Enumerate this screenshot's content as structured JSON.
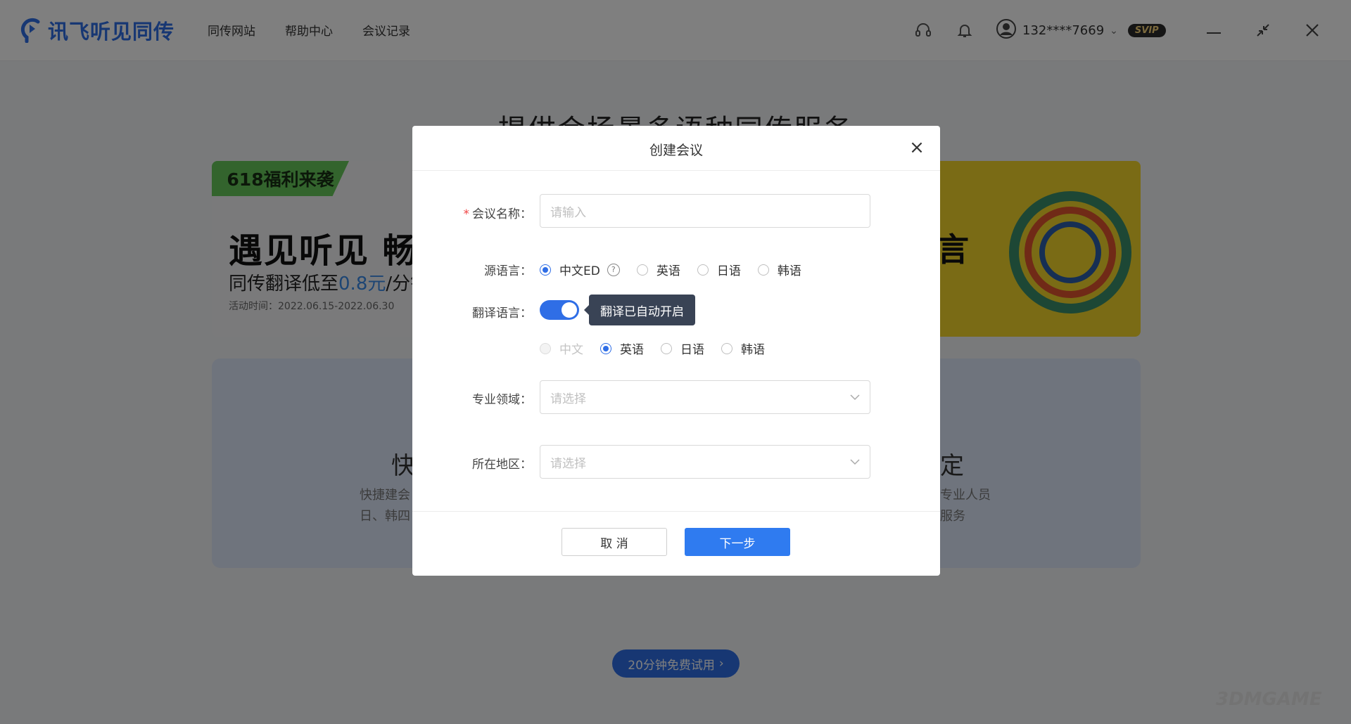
{
  "app": {
    "logo_text": "讯飞听见同传",
    "brand_color": "#2f6ee6"
  },
  "nav": [
    {
      "label": "同传网站"
    },
    {
      "label": "帮助中心"
    },
    {
      "label": "会议记录"
    }
  ],
  "header": {
    "phone": "132****7669",
    "badge": "SVIP",
    "icons": [
      "headset-icon",
      "bell-icon",
      "user-icon",
      "minimize-icon",
      "restore-icon",
      "close-icon"
    ]
  },
  "page": {
    "headline": "提供会场景多语种同传服务",
    "banner": {
      "tag": "618福利来袭",
      "title": "遇见听见 畅享",
      "subtitle_prefix": "同传翻译低至",
      "price": "0.8元",
      "subtitle_suffix": "/分钟",
      "date": "活动时间：2022.06.15-2022.06.30",
      "right_text": "言"
    },
    "features": [
      {
        "title": "快",
        "desc_lines": [
          "快捷建会",
          "日、韩四"
        ]
      },
      {
        "title": "定",
        "desc_lines": [
          "专业人员",
          "服务"
        ]
      }
    ],
    "trial_button": "20分钟免费试用"
  },
  "modal": {
    "title": "创建会议",
    "close": "×",
    "fields": {
      "name": {
        "label": "会议名称：",
        "required_mark": "*",
        "placeholder": "请输入"
      },
      "source_language": {
        "label": "源语言：",
        "options": [
          "中文ED",
          "英语",
          "日语",
          "韩语"
        ],
        "selected": "中文ED"
      },
      "translation": {
        "label": "翻译语言：",
        "toggle_on": true,
        "tooltip": "翻译已自动开启",
        "options": [
          "中文",
          "英语",
          "日语",
          "韩语"
        ],
        "selected": "英语",
        "disabled": "中文"
      },
      "domain": {
        "label": "专业领域：",
        "placeholder": "请选择"
      },
      "region": {
        "label": "所在地区：",
        "placeholder": "请选择"
      }
    },
    "buttons": {
      "cancel": "取 消",
      "next": "下一步"
    }
  },
  "watermark": "3DMGAME"
}
